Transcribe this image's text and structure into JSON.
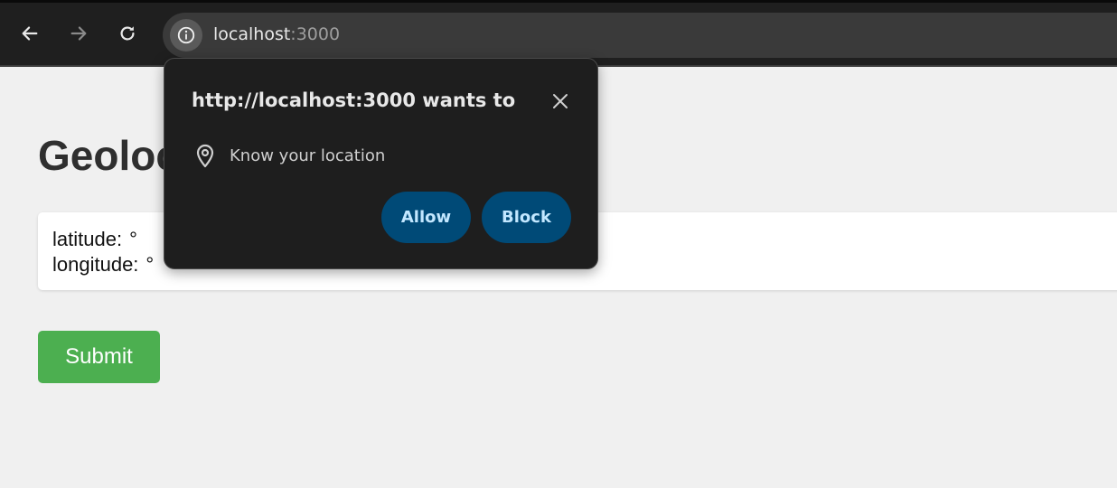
{
  "browser": {
    "url_host": "localhost",
    "url_port": ":3000"
  },
  "page": {
    "title": "Geolocation",
    "latitude_label": "latitude:",
    "latitude_unit": "°",
    "longitude_label": "longitude:",
    "longitude_unit": "°",
    "submit_label": "Submit"
  },
  "permission_popup": {
    "title": "http://localhost:3000 wants to",
    "permission": "Know your location",
    "allow_label": "Allow",
    "block_label": "Block"
  },
  "colors": {
    "toolbar": "#1f1f1f",
    "omnibox": "#3a3a3a",
    "popup_bg": "#1e1e1e",
    "pill_bg": "#004a77",
    "pill_text": "#c2e7ff",
    "submit_bg": "#4caf50",
    "page_bg": "#f0f0f0"
  },
  "icons": [
    "back-arrow-icon",
    "forward-arrow-icon",
    "reload-icon",
    "site-info-icon",
    "close-icon",
    "location-pin-icon"
  ]
}
